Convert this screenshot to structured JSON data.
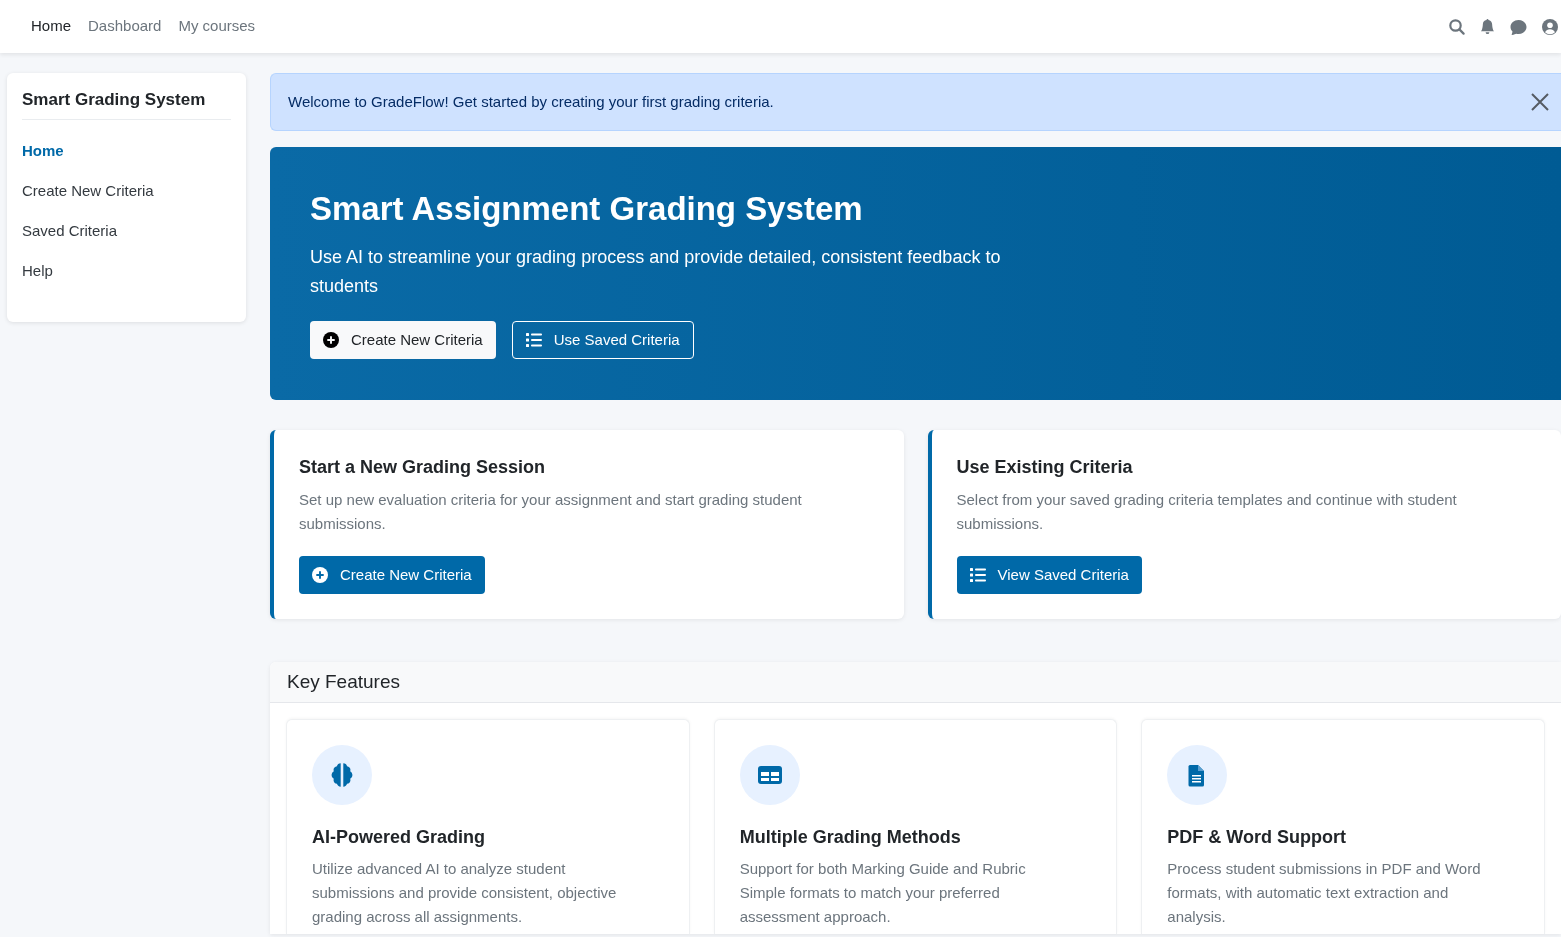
{
  "top_nav": {
    "links": [
      {
        "label": "Home",
        "selected": true
      },
      {
        "label": "Dashboard",
        "selected": false
      },
      {
        "label": "My courses",
        "selected": false
      }
    ]
  },
  "sidebar": {
    "title": "Smart Grading System",
    "items": [
      {
        "label": "Home",
        "selected": true
      },
      {
        "label": "Create New Criteria",
        "selected": false
      },
      {
        "label": "Saved Criteria",
        "selected": false
      },
      {
        "label": "Help",
        "selected": false
      }
    ]
  },
  "alert": {
    "message": "Welcome to GradeFlow! Get started by creating your first grading criteria."
  },
  "hero": {
    "title": "Smart Assignment Grading System",
    "subtitle": "Use AI to streamline your grading process and provide detailed, consistent feedback to students",
    "buttons": [
      {
        "label": "Create New Criteria",
        "kind": "solid"
      },
      {
        "label": "Use Saved Criteria",
        "kind": "outline"
      }
    ]
  },
  "action_cards": [
    {
      "title": "Start a New Grading Session",
      "description": "Set up new evaluation criteria for your assignment and start grading student submissions.",
      "button": "Create New Criteria"
    },
    {
      "title": "Use Existing Criteria",
      "description": "Select from your saved grading criteria templates and continue with student submissions.",
      "button": "View Saved Criteria"
    }
  ],
  "features": {
    "title": "Key Features",
    "items": [
      {
        "title": "AI-Powered Grading",
        "description": "Utilize advanced AI to analyze student submissions and provide consistent, objective grading across all assignments."
      },
      {
        "title": "Multiple Grading Methods",
        "description": "Support for both Marking Guide and Rubric Simple formats to match your preferred assessment approach."
      },
      {
        "title": "PDF & Word Support",
        "description": "Process student submissions in PDF and Word formats, with automatic text extraction and analysis."
      }
    ]
  }
}
